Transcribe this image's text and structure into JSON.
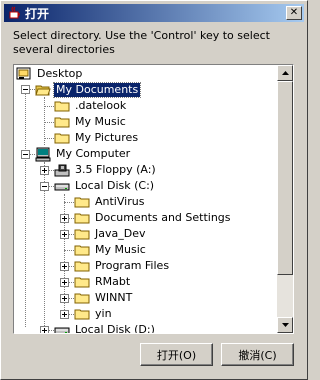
{
  "window": {
    "title": "打开",
    "close_glyph": "✕"
  },
  "instructions": "Select directory. Use the 'Control' key to select several directories",
  "tree": {
    "items": [
      {
        "label": "Desktop",
        "icon": "desktop-icon"
      },
      {
        "label": "My Documents",
        "icon": "folder-open-icon",
        "selected": true
      },
      {
        "label": ".datelook",
        "icon": "folder-icon"
      },
      {
        "label": "My Music",
        "icon": "folder-icon"
      },
      {
        "label": "My Pictures",
        "icon": "folder-icon"
      },
      {
        "label": "My Computer",
        "icon": "computer-icon"
      },
      {
        "label": "3.5 Floppy (A:)",
        "icon": "floppy-icon"
      },
      {
        "label": "Local Disk (C:)",
        "icon": "hard-disk-icon"
      },
      {
        "label": "AntiVirus",
        "icon": "folder-icon"
      },
      {
        "label": "Documents and Settings",
        "icon": "folder-icon"
      },
      {
        "label": "Java_Dev",
        "icon": "folder-icon"
      },
      {
        "label": "My Music",
        "icon": "folder-icon"
      },
      {
        "label": "Program Files",
        "icon": "folder-icon"
      },
      {
        "label": "RMabt",
        "icon": "folder-icon"
      },
      {
        "label": "WINNT",
        "icon": "folder-icon"
      },
      {
        "label": "yin",
        "icon": "folder-icon"
      },
      {
        "label": "Local Disk (D:)",
        "icon": "hard-disk-icon"
      }
    ]
  },
  "buttons": {
    "open": "打开(O)",
    "cancel": "撤消(C)"
  }
}
